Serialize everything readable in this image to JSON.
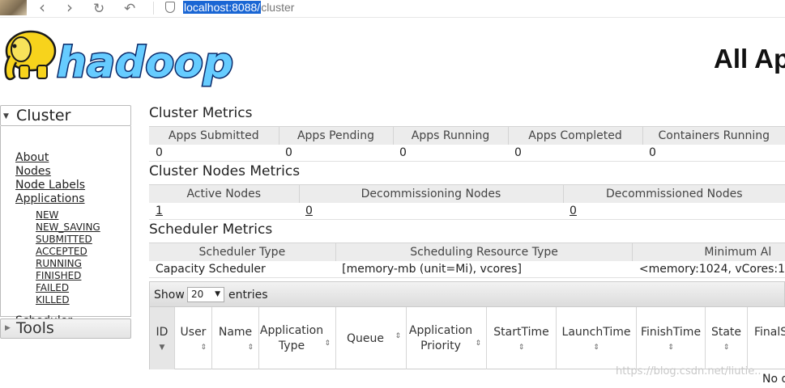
{
  "browser": {
    "url_host": "localhost:8088/",
    "url_path": "cluster",
    "icons": [
      "back-arrow-icon",
      "forward-arrow-icon",
      "reload-icon",
      "undo-icon",
      "shield-icon"
    ]
  },
  "header": {
    "logo_text": "hadoop",
    "page_title": "All Ap"
  },
  "sidebar": {
    "cluster_title": "Cluster",
    "links": [
      "About",
      "Nodes",
      "Node Labels",
      "Applications"
    ],
    "app_states": [
      "NEW",
      "NEW_SAVING",
      "SUBMITTED",
      "ACCEPTED",
      "RUNNING",
      "FINISHED",
      "FAILED",
      "KILLED"
    ],
    "scheduler": "Scheduler",
    "tools_title": "Tools"
  },
  "cluster_metrics": {
    "title": "Cluster Metrics",
    "headers": [
      "Apps Submitted",
      "Apps Pending",
      "Apps Running",
      "Apps Completed",
      "Containers Running"
    ],
    "values": [
      "0",
      "0",
      "0",
      "0",
      "0"
    ]
  },
  "nodes_metrics": {
    "title": "Cluster Nodes Metrics",
    "headers": [
      "Active Nodes",
      "Decommissioning Nodes",
      "Decommissioned Nodes"
    ],
    "values": [
      "1",
      "0",
      "0"
    ]
  },
  "scheduler_metrics": {
    "title": "Scheduler Metrics",
    "headers": [
      "Scheduler Type",
      "Scheduling Resource Type",
      "Minimum Al"
    ],
    "values": [
      "Capacity Scheduler",
      "[memory-mb (unit=Mi), vcores]",
      "<memory:1024, vCores:1"
    ]
  },
  "apps_table": {
    "show_label": "Show",
    "entries_value": "20",
    "entries_label": "entries",
    "columns": [
      "ID",
      "User",
      "Name",
      "Application Type",
      "Queue",
      "Application Priority",
      "StartTime",
      "LaunchTime",
      "FinishTime",
      "State",
      "FinalS"
    ],
    "empty_text": "No d"
  },
  "watermark": "https://blog.csdn.net/liutie.."
}
